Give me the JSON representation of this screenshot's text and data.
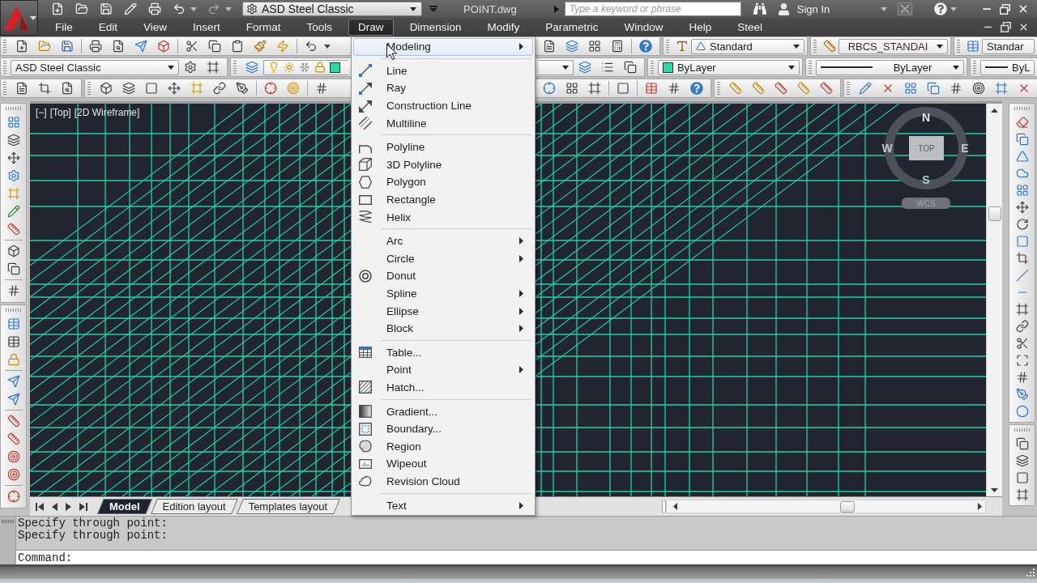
{
  "title_bar": {
    "workspace": "ASD Steel Classic",
    "document": "POINT.dwg",
    "search": {
      "placeholder": "Type a keyword or phrase"
    },
    "sign_in": "Sign In"
  },
  "menu_bar": [
    {
      "label": "File",
      "selected": false
    },
    {
      "label": "Edit",
      "selected": false
    },
    {
      "label": "View",
      "selected": false
    },
    {
      "label": "Insert",
      "selected": false
    },
    {
      "label": "Format",
      "selected": false
    },
    {
      "label": "Tools",
      "selected": false
    },
    {
      "label": "Draw",
      "selected": true
    },
    {
      "label": "Dimension",
      "selected": false
    },
    {
      "label": "Modify",
      "selected": false
    },
    {
      "label": "Parametric",
      "selected": false
    },
    {
      "label": "Window",
      "selected": false
    },
    {
      "label": "Help",
      "selected": false
    },
    {
      "label": "Steel",
      "selected": false
    }
  ],
  "toolbars": {
    "workspace": "ASD Steel Classic",
    "text_style": "Standard",
    "dimension_style": "RBCS_STANDAI",
    "table_style": "Standar",
    "object_color": "ByLayer",
    "linetype": "ByLayer",
    "lineweight": "ByL"
  },
  "viewport": {
    "controls": [
      "[−]",
      "[Top]",
      "[2D Wireframe]"
    ],
    "viewcube": {
      "north": "N",
      "west": "W",
      "face": "TOP",
      "east": "E",
      "south": "S",
      "coordinate_system": "WCS"
    }
  },
  "layout_tabs": [
    {
      "label": "Model",
      "selected": true
    },
    {
      "label": "Edition layout",
      "selected": false
    },
    {
      "label": "Templates layout",
      "selected": false
    }
  ],
  "command_line": {
    "history": [
      "Specify through point:",
      "Specify through point:"
    ],
    "prompt": "Command:"
  },
  "draw_menu": {
    "groups": [
      [
        {
          "label": "Modeling",
          "submenu": true,
          "highlighted": true
        }
      ],
      [
        {
          "label": "Line",
          "submenu": false,
          "highlighted": false
        },
        {
          "label": "Ray",
          "submenu": false,
          "highlighted": false
        },
        {
          "label": "Construction Line",
          "submenu": false,
          "highlighted": false
        },
        {
          "label": "Multiline",
          "submenu": false,
          "highlighted": false
        }
      ],
      [
        {
          "label": "Polyline",
          "submenu": false,
          "highlighted": false
        },
        {
          "label": "3D Polyline",
          "submenu": false,
          "highlighted": false
        },
        {
          "label": "Polygon",
          "submenu": false,
          "highlighted": false
        },
        {
          "label": "Rectangle",
          "submenu": false,
          "highlighted": false
        },
        {
          "label": "Helix",
          "submenu": false,
          "highlighted": false
        }
      ],
      [
        {
          "label": "Arc",
          "submenu": true,
          "highlighted": false
        },
        {
          "label": "Circle",
          "submenu": true,
          "highlighted": false
        },
        {
          "label": "Donut",
          "submenu": false,
          "highlighted": false
        },
        {
          "label": "Spline",
          "submenu": true,
          "highlighted": false
        },
        {
          "label": "Ellipse",
          "submenu": true,
          "highlighted": false
        },
        {
          "label": "Block",
          "submenu": true,
          "highlighted": false
        }
      ],
      [
        {
          "label": "Table...",
          "submenu": false,
          "highlighted": false
        },
        {
          "label": "Point",
          "submenu": true,
          "highlighted": false
        },
        {
          "label": "Hatch...",
          "submenu": false,
          "highlighted": false
        }
      ],
      [
        {
          "label": "Gradient...",
          "submenu": false,
          "highlighted": false
        },
        {
          "label": "Boundary...",
          "submenu": false,
          "highlighted": false
        },
        {
          "label": "Region",
          "submenu": false,
          "highlighted": false
        },
        {
          "label": "Wipeout",
          "submenu": false,
          "highlighted": false
        },
        {
          "label": "Revision Cloud",
          "submenu": false,
          "highlighted": false
        }
      ],
      [
        {
          "label": "Text",
          "submenu": true,
          "highlighted": false
        }
      ]
    ]
  }
}
